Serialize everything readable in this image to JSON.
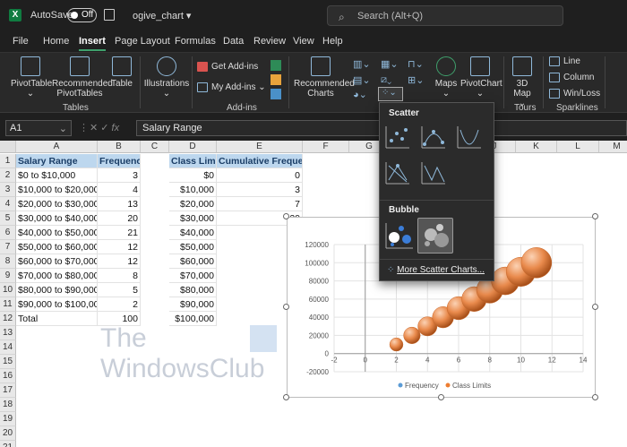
{
  "titlebar": {
    "app_icon": "X",
    "autosave_label": "AutoSave",
    "autosave_state": "Off",
    "doc_name": "ogive_chart",
    "search_placeholder": "Search (Alt+Q)"
  },
  "tabs": [
    "File",
    "Home",
    "Insert",
    "Page Layout",
    "Formulas",
    "Data",
    "Review",
    "View",
    "Help"
  ],
  "active_tab": "Insert",
  "ribbon": {
    "pivottable": "PivotTable",
    "recommended_pivottables": "Recommended PivotTables",
    "table": "Table",
    "illustrations": "Illustrations",
    "get_addins": "Get Add-ins",
    "my_addins": "My Add-ins",
    "recommended_charts": "Recommended Charts",
    "maps": "Maps",
    "pivotchart": "PivotChart",
    "map3d": "3D Map",
    "line": "Line",
    "column": "Column",
    "winloss": "Win/Loss",
    "groups": {
      "tables": "Tables",
      "addins": "Add-ins",
      "tours": "Tours",
      "sparklines": "Sparklines"
    }
  },
  "formula_bar": {
    "cell_ref": "A1",
    "fx": "fx",
    "value": "Salary Range"
  },
  "columns": [
    "A",
    "B",
    "C",
    "D",
    "E",
    "F",
    "G",
    "H",
    "I",
    "J",
    "K",
    "L",
    "M"
  ],
  "rows": [
    "1",
    "2",
    "3",
    "4",
    "5",
    "6",
    "7",
    "8",
    "9",
    "10",
    "11",
    "12",
    "13",
    "14",
    "15",
    "16",
    "17",
    "18",
    "19",
    "20",
    "21"
  ],
  "table": {
    "headers": {
      "salary": "Salary Range",
      "freq": "Frequency",
      "class": "Class Limits",
      "cumul": "Cumulative Frequency"
    },
    "salary": [
      "$0 to $10,000",
      "$10,000 to $20,000",
      "$20,000 to $30,000",
      "$30,000 to $40,000",
      "$40,000 to $50,000",
      "$50,000 to $60,000",
      "$60,000 to $70,000",
      "$70,000 to $80,000",
      "$80,000 to $90,000",
      "$90,000 to $100,000",
      "Total"
    ],
    "freq": [
      "3",
      "4",
      "13",
      "20",
      "21",
      "12",
      "12",
      "8",
      "5",
      "2",
      "100"
    ],
    "class": [
      "$0",
      "$10,000",
      "$20,000",
      "$30,000",
      "$40,000",
      "$50,000",
      "$60,000",
      "$70,000",
      "$80,000",
      "$90,000",
      "$100,000"
    ],
    "cumul": [
      "0",
      "3",
      "7",
      "20"
    ]
  },
  "dropdown": {
    "scatter_label": "Scatter",
    "bubble_label": "Bubble",
    "more": "More Scatter Charts..."
  },
  "watermark": {
    "line1": "The",
    "line2": "WindowsClub"
  },
  "chart_data": {
    "type": "scatter",
    "x": [
      2,
      3,
      4,
      5,
      6,
      7,
      8,
      9,
      10,
      11
    ],
    "series": [
      {
        "name": "Frequency",
        "values": [
          0,
          0,
          0,
          0,
          0,
          0,
          0,
          0,
          0,
          0
        ],
        "color": "#5b9bd5"
      },
      {
        "name": "Class Limits",
        "values": [
          10000,
          20000,
          30000,
          40000,
          50000,
          60000,
          70000,
          80000,
          90000,
          100000
        ],
        "color": "#ed7d31"
      }
    ],
    "xlim": [
      -2,
      14
    ],
    "ylim": [
      -20000,
      120000
    ],
    "x_ticks": [
      "-2",
      "0",
      "2",
      "4",
      "6",
      "8",
      "10",
      "12",
      "14"
    ],
    "y_ticks": [
      "-20000",
      "0",
      "20000",
      "40000",
      "60000",
      "80000",
      "100000",
      "120000"
    ],
    "legend": "bottom"
  }
}
